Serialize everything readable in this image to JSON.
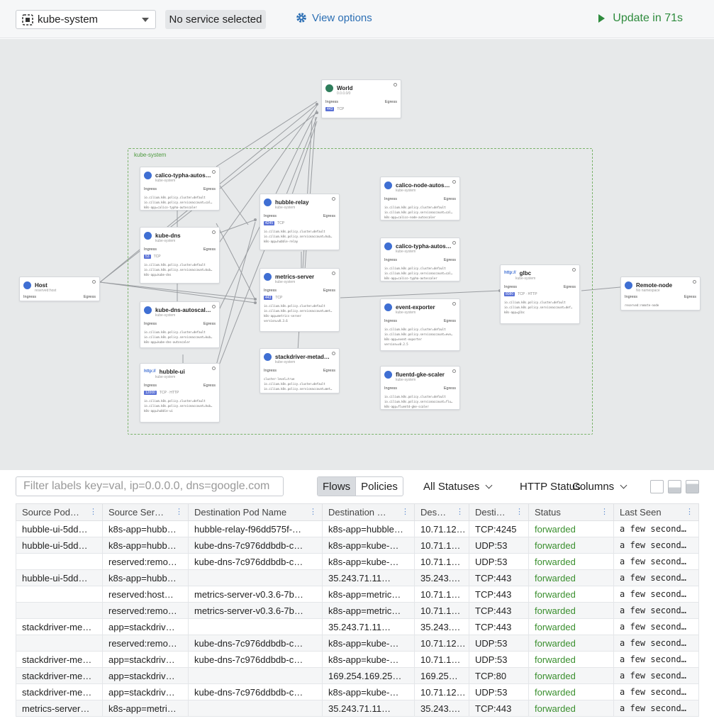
{
  "topbar": {
    "namespace": "kube-system",
    "service_button": "No service selected",
    "view_options": "View options",
    "update_text": "Update in 71s",
    "colors": {
      "accent": "#2c6fb4",
      "update": "#2e8b3d"
    }
  },
  "map": {
    "namespace_label": "kube-system",
    "cards": {
      "world": {
        "title": "World",
        "sub": "0.0.0.0/0",
        "ingress": "Ingress",
        "egress": "Egress",
        "port": "443",
        "proto": "TCP"
      },
      "host": {
        "title": "Host",
        "sub": "reserved:host",
        "ingress": "Ingress",
        "egress": "Egress"
      },
      "calico_typha_autoscaler_left": {
        "title": "calico-typha-autos…",
        "sub": "kube-system",
        "ingress": "Ingress",
        "egress": "Egress",
        "labels": [
          "io.cilium.k8s.policy.cluster=default",
          "io.cilium.k8s.policy.serviceaccount=cal…",
          "k8s-app=calico-typha-autoscaler"
        ]
      },
      "kube_dns": {
        "title": "kube-dns",
        "sub": "kube-system",
        "ingress": "Ingress",
        "egress": "Egress",
        "port": "53",
        "proto": "TCP",
        "labels": [
          "io.cilium.k8s.policy.cluster=default",
          "io.cilium.k8s.policy.serviceaccount=kub…",
          "k8s-app=kube-dns"
        ]
      },
      "kube_dns_autoscaler": {
        "title": "kube-dns-autoscal…",
        "sub": "kube-system",
        "ingress": "Ingress",
        "egress": "Egress",
        "labels": [
          "io.cilium.k8s.policy.cluster=default",
          "io.cilium.k8s.policy.serviceaccount=kub…",
          "k8s-app=kube-dns-autoscaler"
        ]
      },
      "hubble_ui": {
        "title": "hubble-ui",
        "sub": "kube-system",
        "ingress": "Ingress",
        "egress": "Egress",
        "port": "12000",
        "proto": "TCP · HTTP",
        "labels": [
          "io.cilium.k8s.policy.cluster=default",
          "io.cilium.k8s.policy.serviceaccount=hub…",
          "k8s-app=hubble-ui"
        ]
      },
      "hubble_relay": {
        "title": "hubble-relay",
        "sub": "kube-system",
        "ingress": "Ingress",
        "egress": "Egress",
        "port": "4245",
        "proto": "TCP",
        "labels": [
          "io.cilium.k8s.policy.cluster=default",
          "io.cilium.k8s.policy.serviceaccount=hub…",
          "k8s-app=hubble-relay"
        ]
      },
      "metrics_server": {
        "title": "metrics-server",
        "sub": "kube-system",
        "ingress": "Ingress",
        "egress": "Egress",
        "port": "443",
        "proto": "TCP",
        "labels": [
          "io.cilium.k8s.policy.cluster=default",
          "io.cilium.k8s.policy.serviceaccount=met…",
          "k8s-app=metrics-server",
          "version=v0.3.6"
        ]
      },
      "stackdriver": {
        "title": "stackdriver-metad…",
        "sub": "kube-system",
        "ingress": "Ingress",
        "egress": "Egress",
        "labels": [
          "cluster-level=true",
          "io.cilium.k8s.policy.cluster=default",
          "io.cilium.k8s.policy.serviceaccount=met…"
        ]
      },
      "calico_node_autoscaler": {
        "title": "calico-node-autos…",
        "sub": "kube-system",
        "ingress": "Ingress",
        "egress": "Egress",
        "labels": [
          "io.cilium.k8s.policy.cluster=default",
          "io.cilium.k8s.policy.serviceaccount=cal…",
          "k8s-app=calico-node-autoscaler"
        ]
      },
      "calico_typha_autoscaler_right": {
        "title": "calico-typha-autos…",
        "sub": "kube-system",
        "ingress": "Ingress",
        "egress": "Egress",
        "labels": [
          "io.cilium.k8s.policy.cluster=default",
          "io.cilium.k8s.policy.serviceaccount=cal…",
          "k8s-app=calico-typha-autoscaler"
        ]
      },
      "event_exporter": {
        "title": "event-exporter",
        "sub": "kube-system",
        "ingress": "Ingress",
        "egress": "Egress",
        "labels": [
          "io.cilium.k8s.policy.cluster=default",
          "io.cilium.k8s.policy.serviceaccount=eve…",
          "k8s-app=event-exporter",
          "version=v0.2.5"
        ]
      },
      "fluentd_gke_scaler": {
        "title": "fluentd-gke-scaler",
        "sub": "kube-system",
        "ingress": "Ingress",
        "egress": "Egress",
        "labels": [
          "io.cilium.k8s.policy.cluster=default",
          "io.cilium.k8s.policy.serviceaccount=flu…",
          "k8s-app=fluentd-gke-scaler"
        ]
      },
      "glbc": {
        "title": "glbc",
        "sub": "kube-system",
        "ingress": "Ingress",
        "egress": "Egress",
        "port": "8080",
        "proto": "TCP · HTTP",
        "labels": [
          "io.cilium.k8s.policy.cluster=default",
          "io.cilium.k8s.policy.serviceaccount=def…",
          "k8s-app=glbc"
        ]
      },
      "remote_node": {
        "title": "Remote-node",
        "sub": "No namespace",
        "ingress": "Ingress",
        "egress": "Egress",
        "labels": [
          "reserved:remote-node"
        ]
      }
    }
  },
  "toolbar": {
    "filter_placeholder": "Filter labels key=val, ip=0.0.0.0, dns=google.com",
    "tab_flows": "Flows",
    "tab_policies": "Policies",
    "statuses": "All Statuses",
    "http_status": "HTTP Status",
    "columns": "Columns"
  },
  "table": {
    "columns": [
      "Source Pod…",
      "Source Ser…",
      "Destination Pod Name",
      "Destination …",
      "Des…",
      "Desti…",
      "Status",
      "Last Seen"
    ],
    "rows": [
      [
        "hubble-ui-5dd…",
        "k8s-app=hubb…",
        "hubble-relay-f96dd575f-…",
        "k8s-app=hubble…",
        "10.71.12…",
        "TCP:4245",
        "forwarded",
        "a few second…"
      ],
      [
        "hubble-ui-5dd…",
        "k8s-app=hubb…",
        "kube-dns-7c976ddbdb-c…",
        "k8s-app=kube-…",
        "10.71.1…",
        "UDP:53",
        "forwarded",
        "a few second…"
      ],
      [
        "",
        "reserved:remo…",
        "kube-dns-7c976ddbdb-c…",
        "k8s-app=kube-…",
        "10.71.1…",
        "UDP:53",
        "forwarded",
        "a few second…"
      ],
      [
        "hubble-ui-5dd…",
        "k8s-app=hubb…",
        "",
        "35.243.71.11…",
        "35.243.…",
        "TCP:443",
        "forwarded",
        "a few second…"
      ],
      [
        "",
        "reserved:host…",
        "metrics-server-v0.3.6-7b…",
        "k8s-app=metric…",
        "10.71.1…",
        "TCP:443",
        "forwarded",
        "a few second…"
      ],
      [
        "",
        "reserved:remo…",
        "metrics-server-v0.3.6-7b…",
        "k8s-app=metric…",
        "10.71.1…",
        "TCP:443",
        "forwarded",
        "a few second…"
      ],
      [
        "stackdriver-me…",
        "app=stackdriv…",
        "",
        "35.243.71.11…",
        "35.243.…",
        "TCP:443",
        "forwarded",
        "a few second…"
      ],
      [
        "",
        "reserved:remo…",
        "kube-dns-7c976ddbdb-c…",
        "k8s-app=kube-…",
        "10.71.12…",
        "UDP:53",
        "forwarded",
        "a few second…"
      ],
      [
        "stackdriver-me…",
        "app=stackdriv…",
        "kube-dns-7c976ddbdb-c…",
        "k8s-app=kube-…",
        "10.71.1…",
        "UDP:53",
        "forwarded",
        "a few second…"
      ],
      [
        "stackdriver-me…",
        "app=stackdriv…",
        "",
        "169.254.169.25…",
        "169.25…",
        "TCP:80",
        "forwarded",
        "a few second…"
      ],
      [
        "stackdriver-me…",
        "app=stackdriv…",
        "kube-dns-7c976ddbdb-c…",
        "k8s-app=kube-…",
        "10.71.12…",
        "UDP:53",
        "forwarded",
        "a few second…"
      ],
      [
        "metrics-server…",
        "k8s-app=metri…",
        "",
        "35.243.71.11…",
        "35.243.…",
        "TCP:443",
        "forwarded",
        "a few second…"
      ]
    ]
  }
}
